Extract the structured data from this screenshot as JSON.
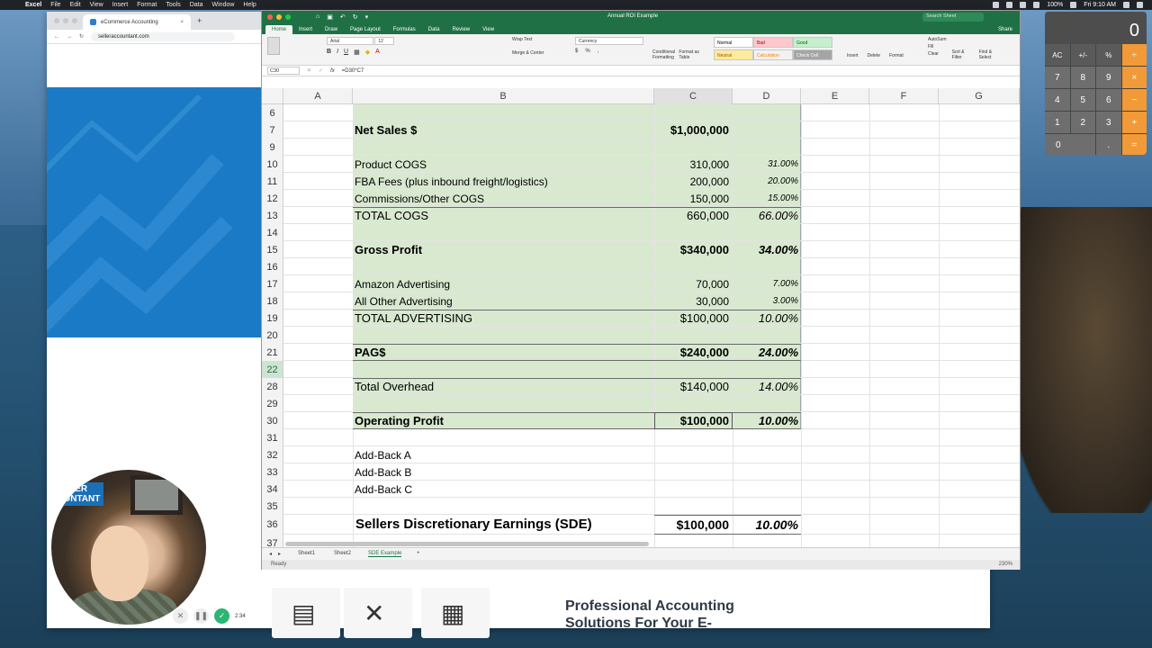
{
  "menubar": {
    "app": "Excel",
    "items": [
      "File",
      "Edit",
      "View",
      "Insert",
      "Format",
      "Tools",
      "Data",
      "Window",
      "Help"
    ],
    "battery": "100%",
    "clock": "Fri 9:10 AM"
  },
  "browser": {
    "tab_title": "eCommerce Accounting",
    "url": "selleraccountant.com",
    "promo_text": "Professional Accounting Solutions For Your E-"
  },
  "excel": {
    "document_title": "Annual ROI Example",
    "search_placeholder": "Search Sheet",
    "share_label": "Share",
    "ribbon_tabs": [
      "Home",
      "Insert",
      "Draw",
      "Page Layout",
      "Formulas",
      "Data",
      "Review",
      "View"
    ],
    "active_tab": "Home",
    "font_name": "Arial",
    "font_size": "12",
    "number_format": "Currency",
    "wrap_text": "Wrap Text",
    "merge_center": "Merge & Center",
    "cond_format": "Conditional Formatting",
    "format_table": "Format as Table",
    "styles": [
      {
        "label": "Normal",
        "bg": "#ffffff",
        "fg": "#000000"
      },
      {
        "label": "Bad",
        "bg": "#ffc7ce",
        "fg": "#9c0006"
      },
      {
        "label": "Good",
        "bg": "#c6efce",
        "fg": "#006100"
      },
      {
        "label": "Neutral",
        "bg": "#ffeb9c",
        "fg": "#9c5700"
      },
      {
        "label": "Calculation",
        "bg": "#f2f2f2",
        "fg": "#fa7d00"
      },
      {
        "label": "Check Cell",
        "bg": "#a5a5a5",
        "fg": "#ffffff"
      }
    ],
    "cells_group": [
      "Insert",
      "Delete",
      "Format"
    ],
    "editing": [
      "AutoSum",
      "Fill",
      "Clear",
      "Sort & Filter",
      "Find & Select"
    ],
    "name_box": "C30",
    "formula": "=D30*C7",
    "column_headers": [
      "A",
      "B",
      "C",
      "D",
      "E",
      "F",
      "G"
    ],
    "selected_column": "C",
    "selected_row": "22",
    "rows": [
      {
        "num": "6",
        "b": "",
        "c": "",
        "d": "",
        "style": "normal"
      },
      {
        "num": "7",
        "b": "Net Sales $",
        "c": "$1,000,000",
        "d": "",
        "style": "bold"
      },
      {
        "num": "9",
        "b": "",
        "c": "",
        "d": "",
        "style": "normal"
      },
      {
        "num": "10",
        "b": "Product COGS",
        "c": "310,000",
        "d": "31.00%",
        "style": "small"
      },
      {
        "num": "11",
        "b": "FBA Fees (plus inbound freight/logistics)",
        "c": "200,000",
        "d": "20.00%",
        "style": "small"
      },
      {
        "num": "12",
        "b": "Commissions/Other COGS",
        "c": "150,000",
        "d": "15.00%",
        "style": "small"
      },
      {
        "num": "13",
        "b": "TOTAL COGS",
        "c": "660,000",
        "d": "66.00%",
        "style": "total"
      },
      {
        "num": "14",
        "b": "",
        "c": "",
        "d": "",
        "style": "normal"
      },
      {
        "num": "15",
        "b": "Gross Profit",
        "c": "$340,000",
        "d": "34.00%",
        "style": "bold"
      },
      {
        "num": "16",
        "b": "",
        "c": "",
        "d": "",
        "style": "normal"
      },
      {
        "num": "17",
        "b": "Amazon Advertising",
        "c": "70,000",
        "d": "7.00%",
        "style": "small"
      },
      {
        "num": "18",
        "b": "All Other Advertising",
        "c": "30,000",
        "d": "3.00%",
        "style": "small"
      },
      {
        "num": "19",
        "b": "TOTAL ADVERTISING",
        "c": "$100,000",
        "d": "10.00%",
        "style": "total"
      },
      {
        "num": "20",
        "b": "",
        "c": "",
        "d": "",
        "style": "normal"
      },
      {
        "num": "21",
        "b": "PAG$",
        "c": "$240,000",
        "d": "24.00%",
        "style": "bold"
      },
      {
        "num": "22",
        "b": "",
        "c": "",
        "d": "",
        "style": "normal"
      },
      {
        "num": "28",
        "b": "Total Overhead",
        "c": "$140,000",
        "d": "14.00%",
        "style": "total"
      },
      {
        "num": "29",
        "b": "",
        "c": "",
        "d": "",
        "style": "normal"
      },
      {
        "num": "30",
        "b": "Operating Profit",
        "c": "$100,000",
        "d": "10.00%",
        "style": "bold"
      },
      {
        "num": "31",
        "b": "",
        "c": "",
        "d": "",
        "style": "normal"
      },
      {
        "num": "32",
        "b": "Add-Back A",
        "c": "",
        "d": "",
        "style": "plain"
      },
      {
        "num": "33",
        "b": "Add-Back B",
        "c": "",
        "d": "",
        "style": "plain"
      },
      {
        "num": "34",
        "b": "Add-Back C",
        "c": "",
        "d": "",
        "style": "plain"
      },
      {
        "num": "35",
        "b": "",
        "c": "",
        "d": "",
        "style": "normal"
      },
      {
        "num": "36",
        "b": "Sellers Discretionary Earnings (SDE)",
        "c": "$100,000",
        "d": "10.00%",
        "style": "sde"
      },
      {
        "num": "37",
        "b": "",
        "c": "",
        "d": "",
        "style": "normal"
      }
    ],
    "sheet_tabs": [
      "Sheet1",
      "Sheet2",
      "SDE Example"
    ],
    "active_sheet": "SDE Example",
    "status": "Ready",
    "zoom": "230%"
  },
  "calculator": {
    "display": "0",
    "keys": [
      "AC",
      "+/-",
      "%",
      "÷",
      "7",
      "8",
      "9",
      "×",
      "4",
      "5",
      "6",
      "−",
      "1",
      "2",
      "3",
      "+",
      "0",
      ".",
      "="
    ]
  },
  "webcam": {
    "logo_lines": [
      "LLER",
      "UNTANT"
    ],
    "timer": "2:34"
  }
}
